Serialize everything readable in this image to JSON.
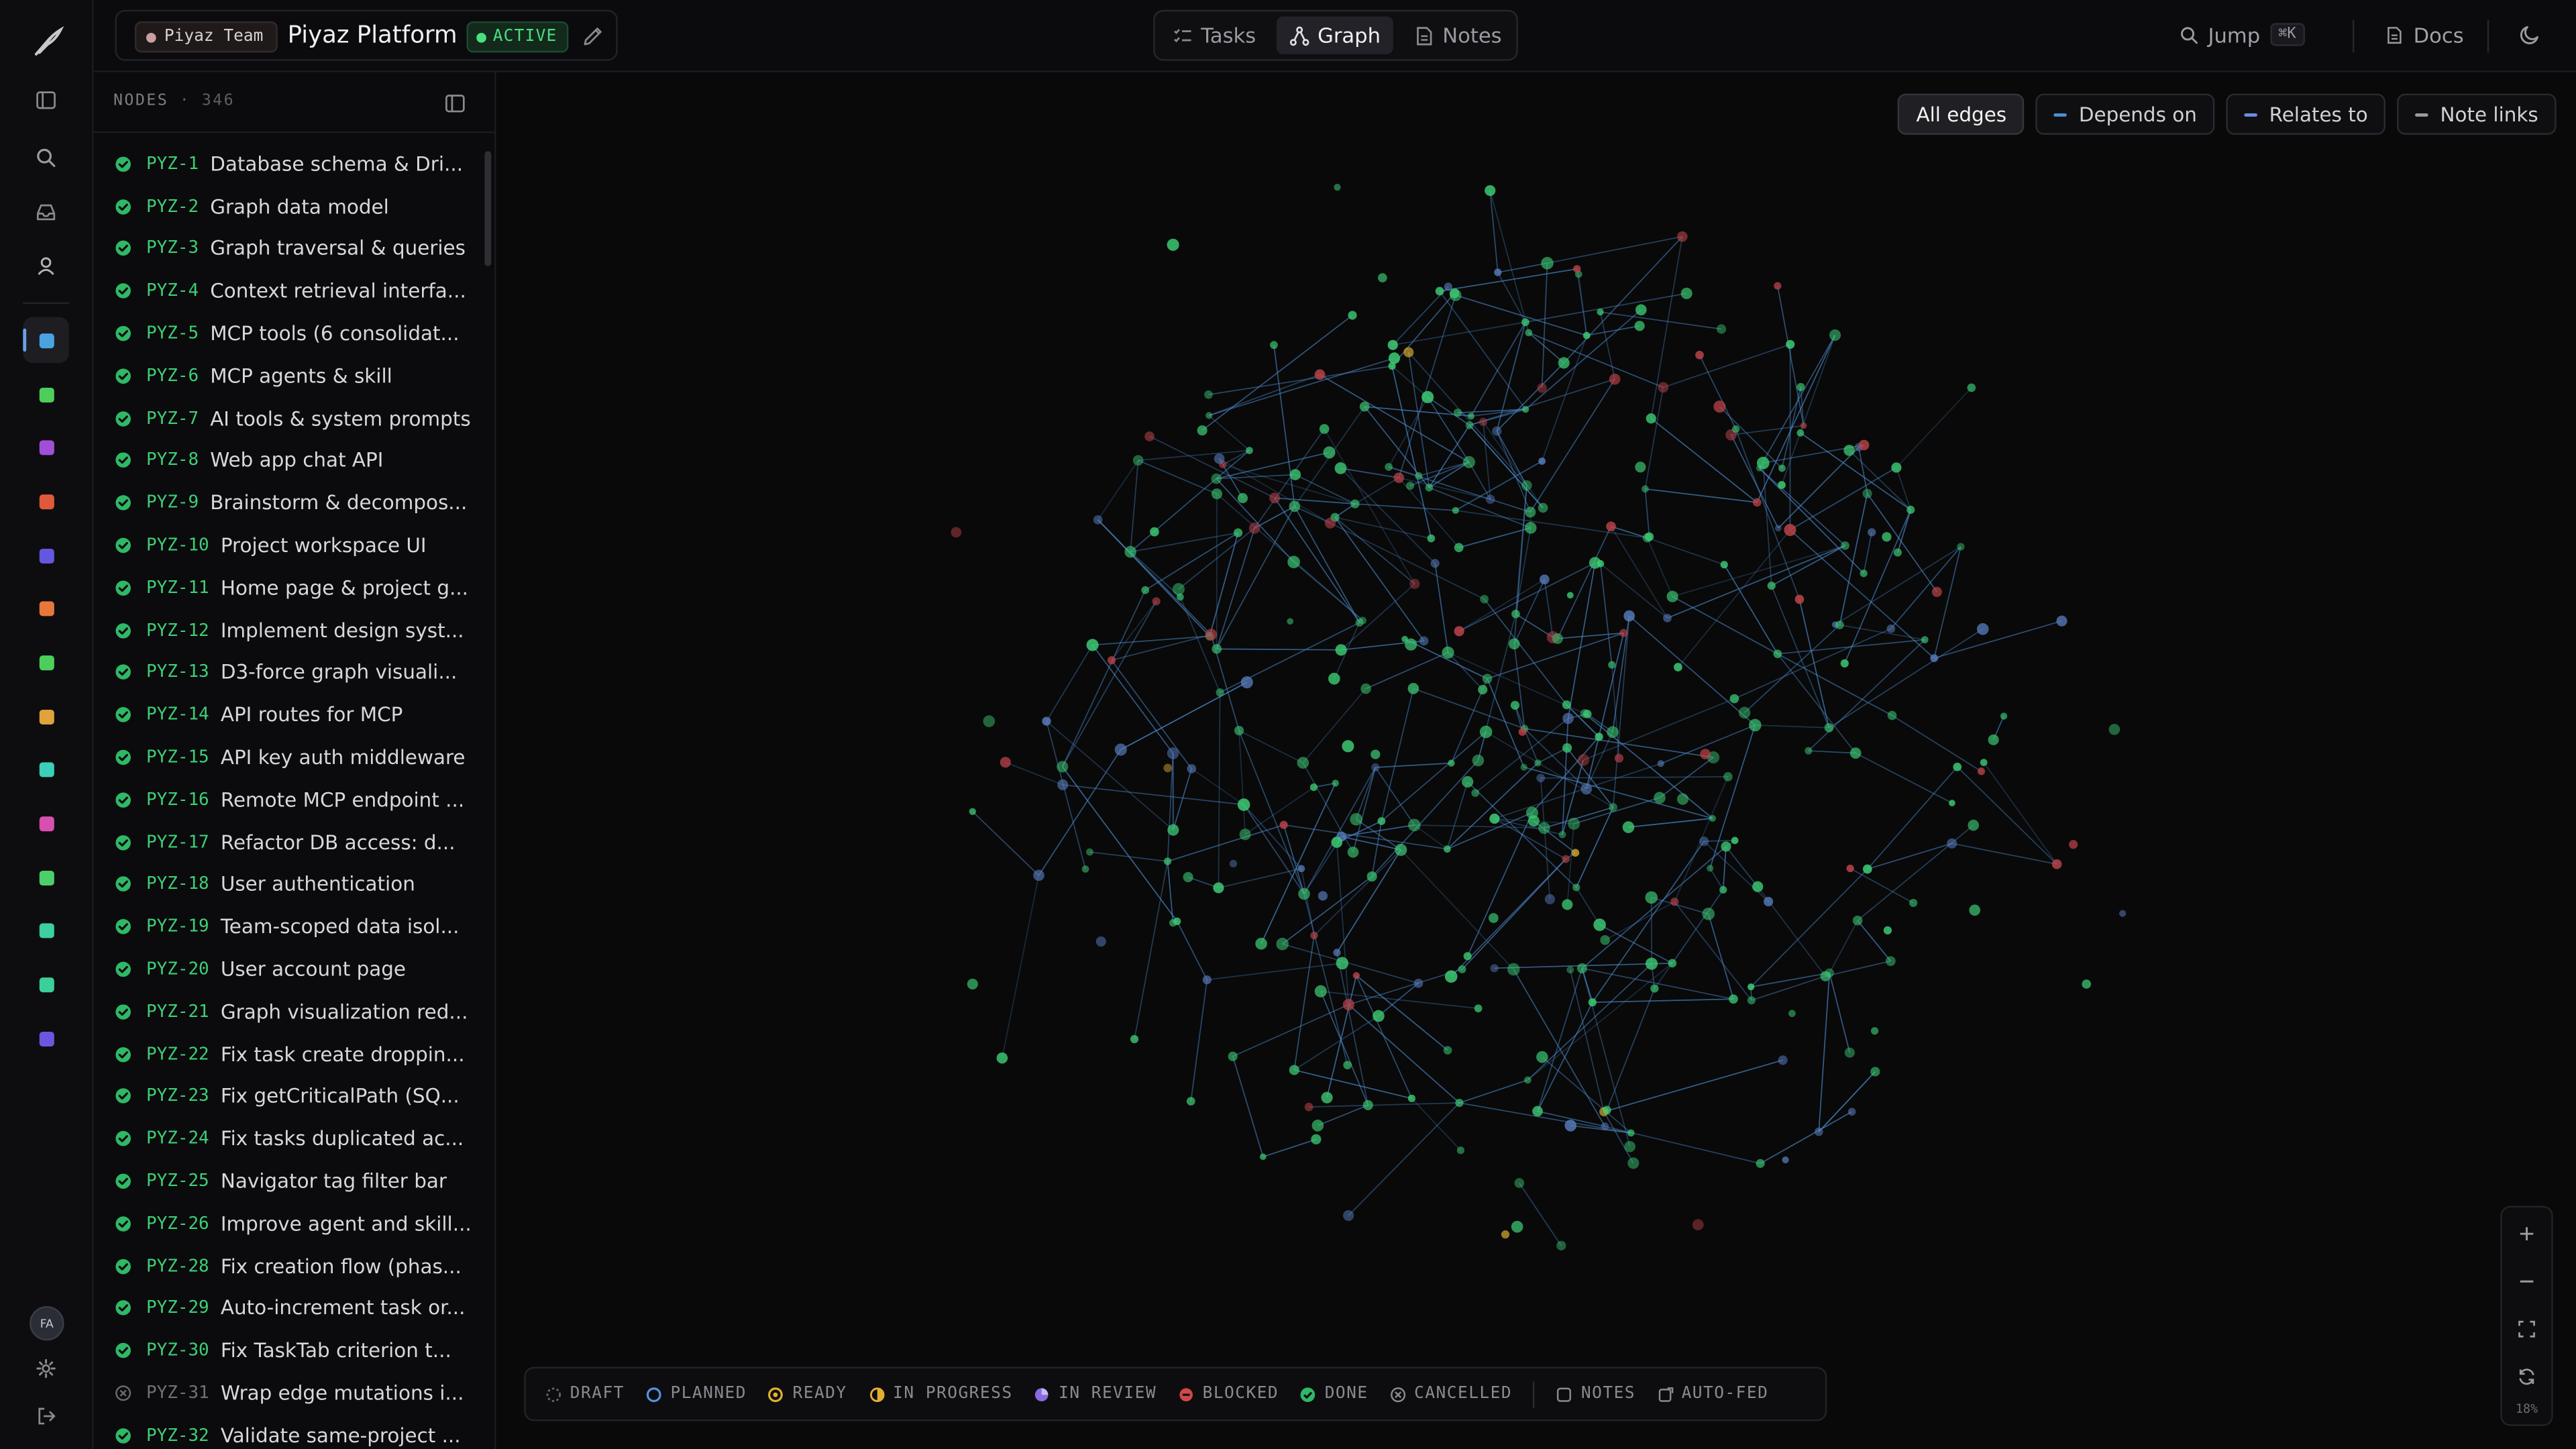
{
  "header": {
    "team": "Piyaz Team",
    "project": "Piyaz Platform",
    "status": "ACTIVE",
    "tabs": [
      {
        "label": "Tasks",
        "icon": "tasks-icon",
        "active": false
      },
      {
        "label": "Graph",
        "icon": "graph-icon",
        "active": true
      },
      {
        "label": "Notes",
        "icon": "notes-icon",
        "active": false
      }
    ],
    "jump_label": "Jump",
    "jump_shortcut": "⌘K",
    "docs_label": "Docs"
  },
  "rail": {
    "project_colors": [
      "#4aa3e0",
      "#4ccf5a",
      "#a24fd8",
      "#e0583c",
      "#6457e0",
      "#e8773c",
      "#4ccf5a",
      "#e0a23c",
      "#3ccfb8",
      "#d84fb0",
      "#4ccf6a",
      "#3ccfa0",
      "#3ccf9a",
      "#6a57e0"
    ],
    "avatar_initials": "FA"
  },
  "sidebar": {
    "title": "NODES",
    "count": "346",
    "nodes": [
      {
        "key": "PYZ-1",
        "title": "Database schema & Dri...",
        "status": "done"
      },
      {
        "key": "PYZ-2",
        "title": "Graph data model",
        "status": "done"
      },
      {
        "key": "PYZ-3",
        "title": "Graph traversal & queries",
        "status": "done"
      },
      {
        "key": "PYZ-4",
        "title": "Context retrieval interfa...",
        "status": "done"
      },
      {
        "key": "PYZ-5",
        "title": "MCP tools (6 consolidat...",
        "status": "done"
      },
      {
        "key": "PYZ-6",
        "title": "MCP agents & skill",
        "status": "done"
      },
      {
        "key": "PYZ-7",
        "title": "AI tools & system prompts",
        "status": "done"
      },
      {
        "key": "PYZ-8",
        "title": "Web app chat API",
        "status": "done"
      },
      {
        "key": "PYZ-9",
        "title": "Brainstorm & decompos...",
        "status": "done"
      },
      {
        "key": "PYZ-10",
        "title": "Project workspace UI",
        "status": "done"
      },
      {
        "key": "PYZ-11",
        "title": "Home page & project g...",
        "status": "done"
      },
      {
        "key": "PYZ-12",
        "title": "Implement design syst...",
        "status": "done"
      },
      {
        "key": "PYZ-13",
        "title": "D3-force graph visuali...",
        "status": "done"
      },
      {
        "key": "PYZ-14",
        "title": "API routes for MCP",
        "status": "done"
      },
      {
        "key": "PYZ-15",
        "title": "API key auth middleware",
        "status": "done"
      },
      {
        "key": "PYZ-16",
        "title": "Remote MCP endpoint ...",
        "status": "done"
      },
      {
        "key": "PYZ-17",
        "title": "Refactor DB access: d...",
        "status": "done"
      },
      {
        "key": "PYZ-18",
        "title": "User authentication",
        "status": "done"
      },
      {
        "key": "PYZ-19",
        "title": "Team-scoped data isol...",
        "status": "done"
      },
      {
        "key": "PYZ-20",
        "title": "User account page",
        "status": "done"
      },
      {
        "key": "PYZ-21",
        "title": "Graph visualization red...",
        "status": "done"
      },
      {
        "key": "PYZ-22",
        "title": "Fix task create droppin...",
        "status": "done"
      },
      {
        "key": "PYZ-23",
        "title": "Fix getCriticalPath (SQ...",
        "status": "done"
      },
      {
        "key": "PYZ-24",
        "title": "Fix tasks duplicated ac...",
        "status": "done"
      },
      {
        "key": "PYZ-25",
        "title": "Navigator tag filter bar",
        "status": "done"
      },
      {
        "key": "PYZ-26",
        "title": "Improve agent and skill...",
        "status": "done"
      },
      {
        "key": "PYZ-28",
        "title": "Fix creation flow (phas...",
        "status": "done"
      },
      {
        "key": "PYZ-29",
        "title": "Auto-increment task or...",
        "status": "done"
      },
      {
        "key": "PYZ-30",
        "title": "Fix TaskTab criterion t...",
        "status": "done"
      },
      {
        "key": "PYZ-31",
        "title": "Wrap edge mutations i...",
        "status": "cancelled"
      },
      {
        "key": "PYZ-32",
        "title": "Validate same-project ...",
        "status": "done"
      }
    ]
  },
  "edge_filters": [
    {
      "label": "All edges",
      "active": true,
      "color": ""
    },
    {
      "label": "Depends on",
      "active": false,
      "color": "#4a8fd8"
    },
    {
      "label": "Relates to",
      "active": false,
      "color": "#6a8fe0"
    },
    {
      "label": "Note links",
      "active": false,
      "color": "#9a9aa2"
    }
  ],
  "legend": [
    {
      "label": "DRAFT",
      "icon": "draft-icon"
    },
    {
      "label": "PLANNED",
      "icon": "planned-icon"
    },
    {
      "label": "READY",
      "icon": "ready-icon"
    },
    {
      "label": "IN PROGRESS",
      "icon": "in-progress-icon"
    },
    {
      "label": "IN REVIEW",
      "icon": "in-review-icon"
    },
    {
      "label": "BLOCKED",
      "icon": "blocked-icon"
    },
    {
      "label": "DONE",
      "icon": "done-icon"
    },
    {
      "label": "CANCELLED",
      "icon": "cancelled-icon"
    },
    {
      "label": "NOTES",
      "icon": "notes-icon"
    },
    {
      "label": "AUTO-FED",
      "icon": "auto-fed-icon"
    }
  ],
  "zoom_level": "18%",
  "colors": {
    "done": "#3ecf76",
    "planned": "#5a7fc0",
    "blocked": "#c0444a",
    "ready": "#e0b030",
    "edge": "#4a88c8"
  }
}
